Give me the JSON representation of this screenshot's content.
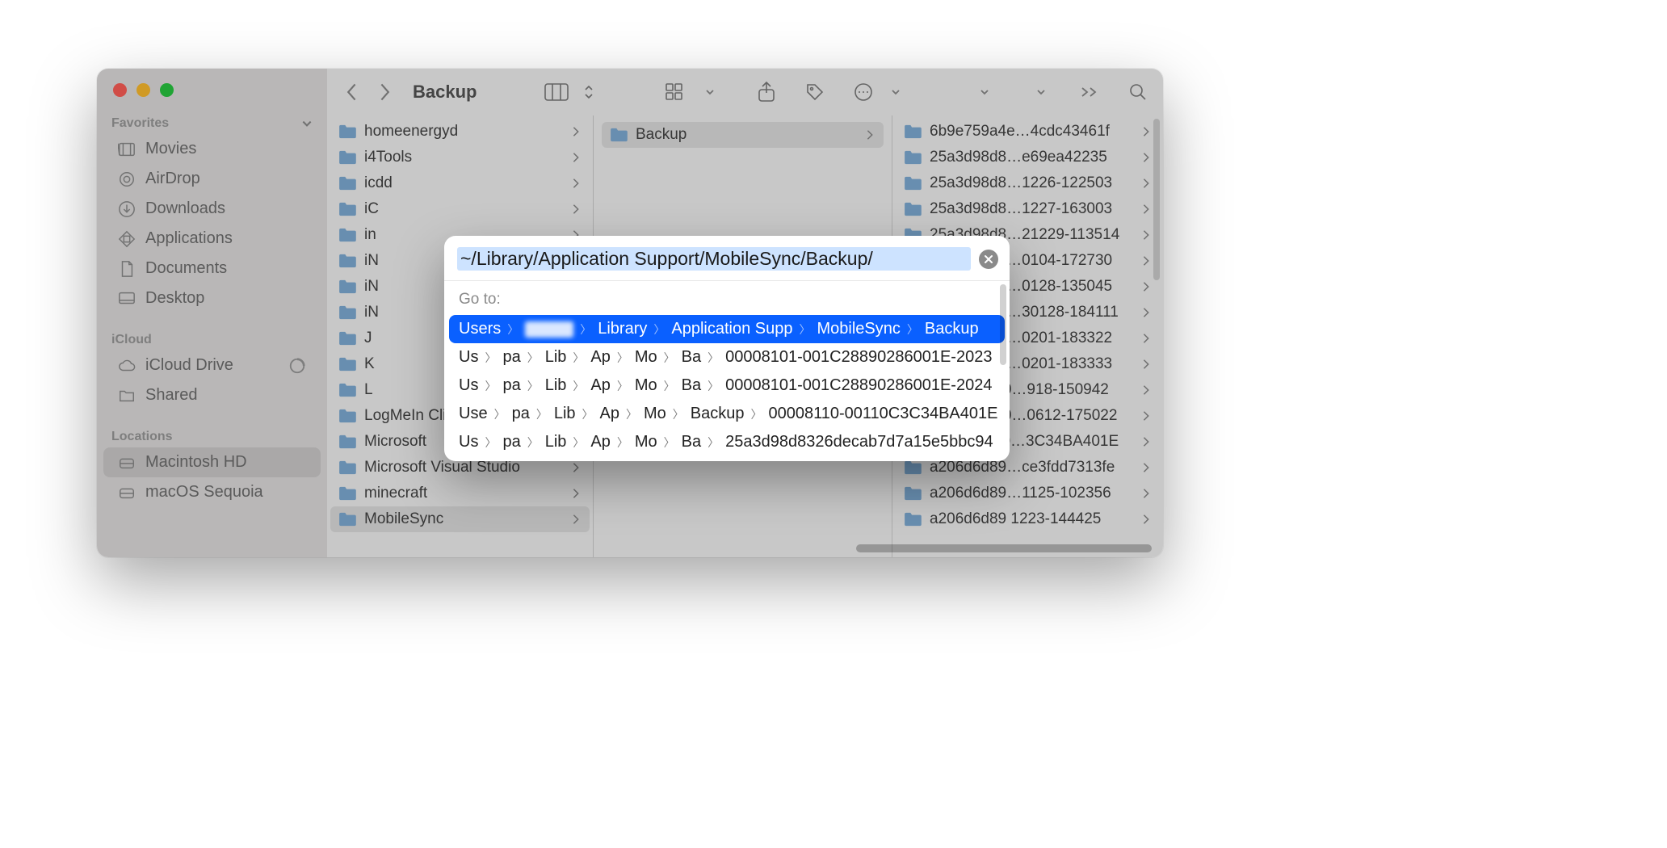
{
  "window": {
    "title": "Backup"
  },
  "sidebar": {
    "sections": [
      {
        "label": "Favorites",
        "items": [
          {
            "icon": "movies",
            "label": "Movies"
          },
          {
            "icon": "airdrop",
            "label": "AirDrop"
          },
          {
            "icon": "downloads",
            "label": "Downloads"
          },
          {
            "icon": "applications",
            "label": "Applications"
          },
          {
            "icon": "documents",
            "label": "Documents"
          },
          {
            "icon": "desktop",
            "label": "Desktop"
          }
        ]
      },
      {
        "label": "iCloud",
        "items": [
          {
            "icon": "cloud",
            "label": "iCloud Drive",
            "progress": true
          },
          {
            "icon": "folder",
            "label": "Shared"
          }
        ]
      },
      {
        "label": "Locations",
        "items": [
          {
            "icon": "disk",
            "label": "Macintosh HD",
            "selected": true
          },
          {
            "icon": "disk",
            "label": "macOS Sequoia"
          }
        ]
      }
    ]
  },
  "columns": {
    "col1": [
      {
        "name": "homeenergyd"
      },
      {
        "name": "i4Tools"
      },
      {
        "name": "icdd"
      },
      {
        "name": "iC"
      },
      {
        "name": "in"
      },
      {
        "name": "iN"
      },
      {
        "name": "iN"
      },
      {
        "name": "iN"
      },
      {
        "name": "J"
      },
      {
        "name": "K"
      },
      {
        "name": "L"
      },
      {
        "name": "LogMeIn Client"
      },
      {
        "name": "Microsoft"
      },
      {
        "name": "Microsoft Visual Studio"
      },
      {
        "name": "minecraft"
      },
      {
        "name": "MobileSync",
        "selected": true
      }
    ],
    "col2": [
      {
        "name": "Backup",
        "selected": true
      }
    ],
    "col3": [
      {
        "name": "6b9e759a4e…4cdc43461f"
      },
      {
        "name": "25a3d98d8…e69ea42235"
      },
      {
        "name": "25a3d98d8…1226-122503"
      },
      {
        "name": "25a3d98d8…1227-163003"
      },
      {
        "name": "25a3d98d8…21229-113514"
      },
      {
        "name": "25a3d98d8…0104-172730"
      },
      {
        "name": "25a3d98d8…0128-135045"
      },
      {
        "name": "25a3d98d8…30128-184111"
      },
      {
        "name": "25a3d98d8…0201-183322"
      },
      {
        "name": "25a3d98d8…0201-183333"
      },
      {
        "name": "00008101-0…918-150942"
      },
      {
        "name": "00008101-0…0612-175022"
      },
      {
        "name": "00008110-0…3C34BA401E"
      },
      {
        "name": "a206d6d89…ce3fdd7313fe"
      },
      {
        "name": "a206d6d89…1125-102356"
      },
      {
        "name": "a206d6d89  1223-144425"
      }
    ]
  },
  "goto": {
    "input": "~/Library/Application Support/MobileSync/Backup/",
    "label": "Go to:",
    "suggestions": [
      {
        "selected": true,
        "crumbs": [
          "Users",
          "__REDACTED__",
          "Library",
          "Application Supp",
          "MobileSync",
          "Backup"
        ]
      },
      {
        "crumbs": [
          "Us",
          "pa",
          "Lib",
          "Ap",
          "Mo",
          "Ba",
          "00008101-001C28890286001E-2023"
        ]
      },
      {
        "crumbs": [
          "Us",
          "pa",
          "Lib",
          "Ap",
          "Mo",
          "Ba",
          "00008101-001C28890286001E-2024"
        ]
      },
      {
        "crumbs": [
          "Use",
          "pa",
          "Lib",
          "Ap",
          "Mo",
          "Backup",
          "00008110-00110C3C34BA401E"
        ]
      },
      {
        "crumbs": [
          "Us",
          "pa",
          "Lib",
          "Ap",
          "Mo",
          "Ba",
          "25a3d98d8326decab7d7a15e5bbc94"
        ]
      }
    ]
  }
}
